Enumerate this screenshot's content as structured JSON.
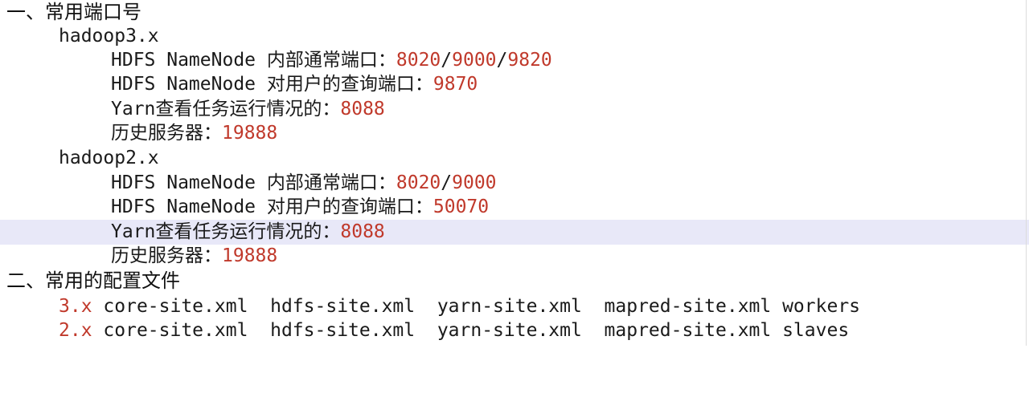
{
  "editor": {
    "section1": {
      "title": "一、常用端口号"
    },
    "hadoop3": {
      "label": "hadoop3.x",
      "l1": {
        "label": "HDFS NameNode 内部通常端口：",
        "p1": "8020",
        "s1": "/",
        "p2": "9000",
        "s2": "/",
        "p3": "9820"
      },
      "l2": {
        "label": "HDFS NameNode 对用户的查询端口：",
        "port": "9870"
      },
      "l3": {
        "label": "Yarn查看任务运行情况的：",
        "port": "8088"
      },
      "l4": {
        "label": "历史服务器：",
        "port": "19888"
      }
    },
    "hadoop2": {
      "label": "hadoop2.x",
      "l1": {
        "label": "HDFS NameNode 内部通常端口：",
        "p1": "8020",
        "s1": "/",
        "p2": "9000"
      },
      "l2": {
        "label": "HDFS NameNode 对用户的查询端口：",
        "port": "50070"
      },
      "l3": {
        "label": "Yarn查看任务运行情况的：",
        "port": "8088"
      },
      "l4": {
        "label": "历史服务器：",
        "port": "19888"
      }
    },
    "section2": {
      "title": "二、常用的配置文件"
    },
    "config3": {
      "version": "3.x",
      "files": "core-site.xml  hdfs-site.xml  yarn-site.xml  mapred-site.xml workers"
    },
    "config2": {
      "version": "2.x",
      "files": "core-site.xml  hdfs-site.xml  yarn-site.xml  mapred-site.xml slaves"
    },
    "colors": {
      "port": "#c0392b",
      "current_line": "#e8e8f8"
    }
  }
}
